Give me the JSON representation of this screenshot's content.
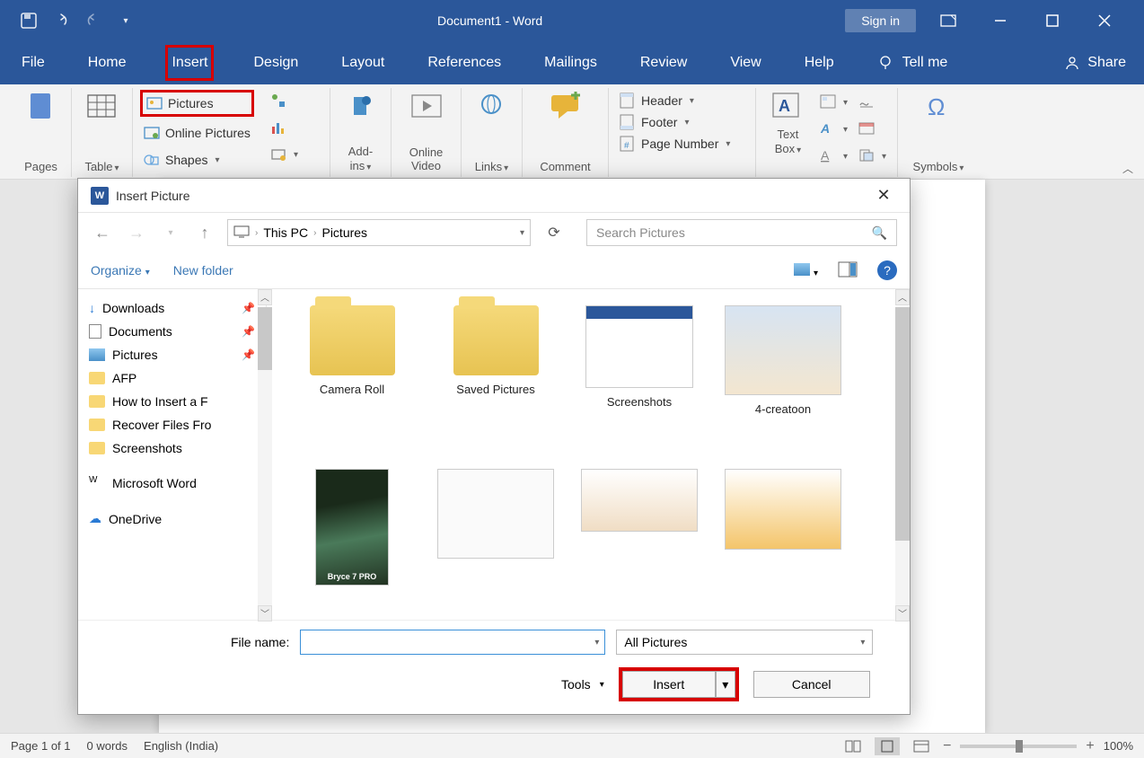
{
  "titlebar": {
    "title": "Document1  -  Word",
    "signin": "Sign in"
  },
  "tabs": {
    "file": "File",
    "home": "Home",
    "insert": "Insert",
    "design": "Design",
    "layout": "Layout",
    "references": "References",
    "mailings": "Mailings",
    "review": "Review",
    "view": "View",
    "help": "Help",
    "tellme": "Tell me",
    "share": "Share"
  },
  "ribbon": {
    "pages": "Pages",
    "table": "Table",
    "pictures": "Pictures",
    "online_pictures": "Online Pictures",
    "shapes": "Shapes",
    "addins": "Add-ins",
    "online_video": "Online Video",
    "links": "Links",
    "comment": "Comment",
    "header": "Header",
    "footer": "Footer",
    "page_number": "Page Number",
    "textbox": "Text Box",
    "symbols": "Symbols",
    "text": "Text"
  },
  "dialog": {
    "title": "Insert Picture",
    "crumbs": [
      "This PC",
      "Pictures"
    ],
    "search_placeholder": "Search Pictures",
    "organize": "Organize",
    "new_folder": "New folder",
    "tree": {
      "downloads": "Downloads",
      "documents": "Documents",
      "pictures": "Pictures",
      "afp": "AFP",
      "howto": "How to Insert a F",
      "recover": "Recover Files Fro",
      "screenshots": "Screenshots",
      "msword": "Microsoft Word",
      "onedrive": "OneDrive"
    },
    "files": {
      "f0": "Camera Roll",
      "f1": "Saved Pictures",
      "f2": "Screenshots",
      "f3": "4-creatoon",
      "f4": "Bryce 7 PRO"
    },
    "fn_label": "File name:",
    "filter": "All Pictures",
    "tools": "Tools",
    "insert": "Insert",
    "cancel": "Cancel"
  },
  "status": {
    "page": "Page 1 of 1",
    "words": "0 words",
    "lang": "English (India)",
    "zoom": "100%"
  }
}
